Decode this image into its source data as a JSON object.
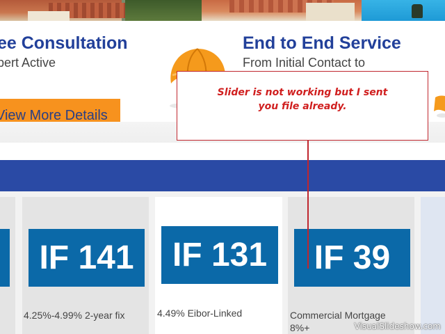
{
  "slider": {
    "left_slide": {
      "title": "ee Consultation",
      "subtitle": "pert Active",
      "button_label": "View More Details"
    },
    "right_slide": {
      "title": "End to End Service",
      "subtitle": "From Initial Contact to"
    }
  },
  "annotation": {
    "text": "Slider is not working but I sent you file already."
  },
  "products": [
    {
      "badge": "",
      "caption": ""
    },
    {
      "badge": "IF 141",
      "caption": "4.25%-4.99% 2-year fix"
    },
    {
      "badge": "IF 131",
      "caption": "4.49% Eibor-Linked"
    },
    {
      "badge": "IF 39",
      "caption": "Commercial Mortgage\n8%+"
    }
  ],
  "watermark": "VisualSlideshow.com",
  "colors": {
    "brand_blue": "#2a4aa5",
    "badge_blue": "#0b69a8",
    "cta_orange": "#f7921e",
    "title_blue": "#22409a",
    "annotation_red": "#d01f1f"
  },
  "icons": [
    "umbrella-icon",
    "umbrella-icon"
  ]
}
